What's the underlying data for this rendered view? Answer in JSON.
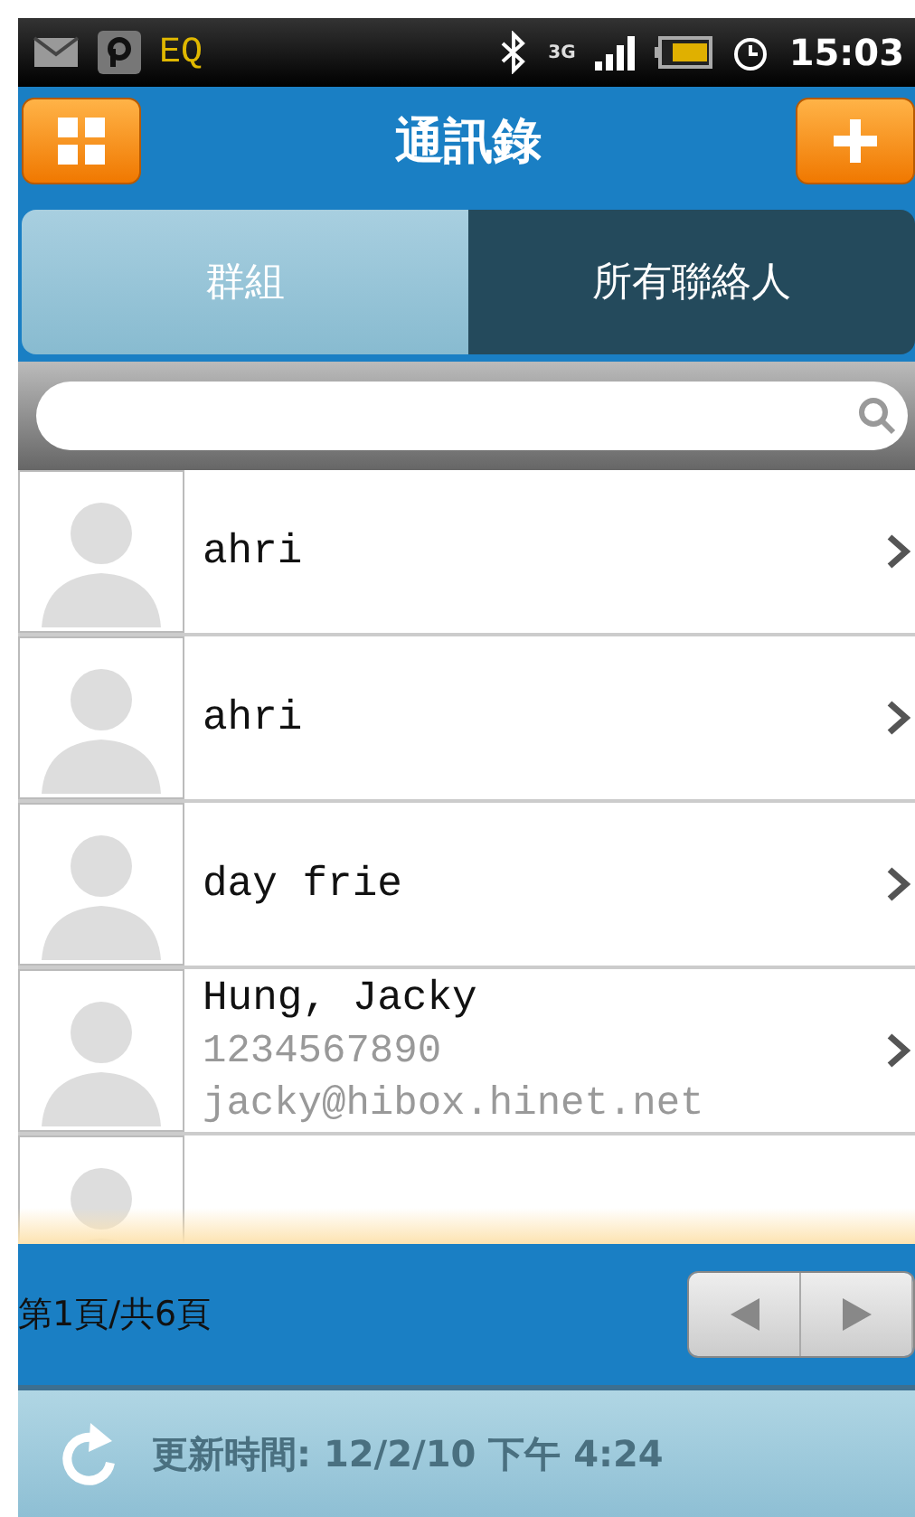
{
  "status_bar": {
    "app_label": "EQ",
    "network": "3G",
    "time": "15:03"
  },
  "header": {
    "title": "通訊錄"
  },
  "tabs": [
    {
      "label": "群組",
      "selected": false
    },
    {
      "label": "所有聯絡人",
      "selected": true
    }
  ],
  "contacts": [
    {
      "name": "ahri"
    },
    {
      "name": "ahri"
    },
    {
      "name": "day frie"
    },
    {
      "name": "Hung, Jacky",
      "lines": [
        "1234567890",
        "jacky@hibox.hinet.net"
      ]
    }
  ],
  "pager": {
    "label": "第1頁/共6頁"
  },
  "footer": {
    "updated": "更新時間: 12/2/10 下午 4:24"
  }
}
